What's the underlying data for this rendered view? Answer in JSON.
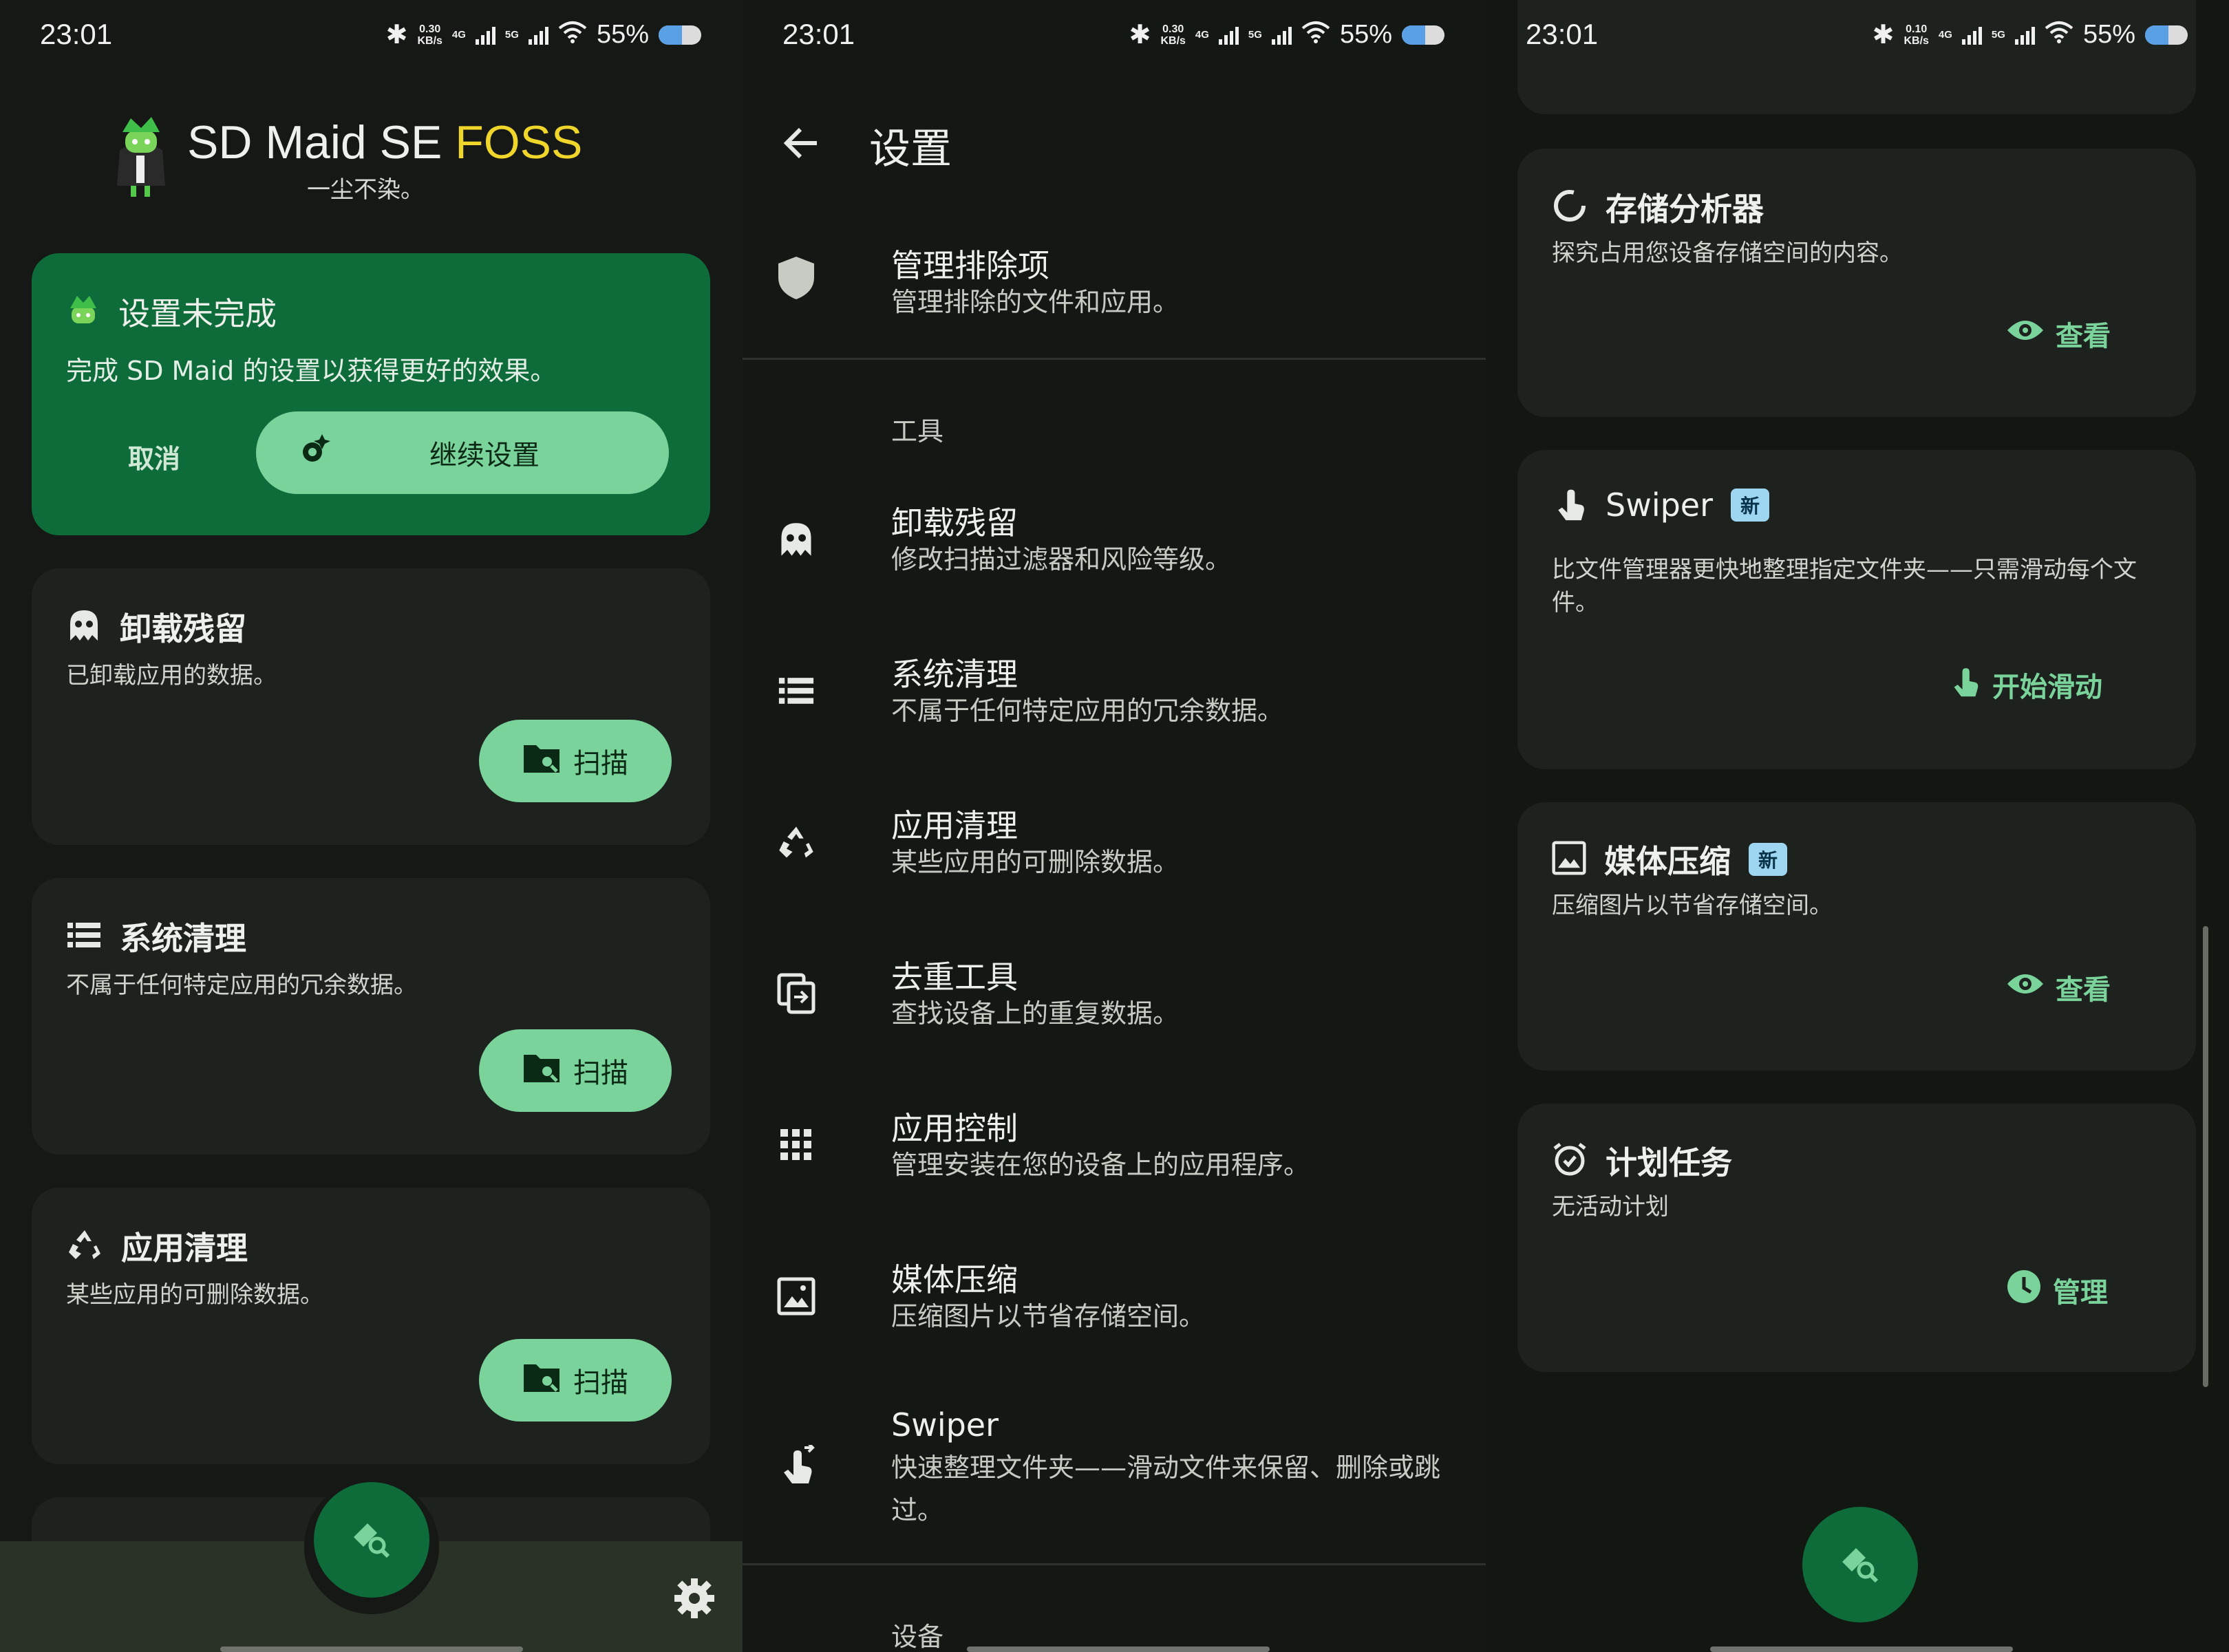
{
  "status_bar": [
    {
      "time": "23:01",
      "speed": "0.30",
      "speed_unit": "KB/s",
      "net1": "4G",
      "net2": "5G",
      "battery": "55%",
      "battery_level": 0.55
    },
    {
      "time": "23:01",
      "speed": "0.30",
      "speed_unit": "KB/s",
      "net1": "4G",
      "net2": "5G",
      "battery": "55%",
      "battery_level": 0.55
    },
    {
      "time": "23:01",
      "speed": "0.10",
      "speed_unit": "KB/s",
      "net1": "4G",
      "net2": "5G",
      "battery": "55%",
      "battery_level": 0.55
    }
  ],
  "dashboard": {
    "app_name_main": "SD Maid SE ",
    "app_name_accent": "FOSS",
    "tagline": "一尘不染。",
    "setup_card": {
      "title": "设置未完成",
      "description": "完成 SD Maid 的设置以获得更好的效果。",
      "cancel_label": "取消",
      "continue_label": "继续设置"
    },
    "tool_cards": [
      {
        "title": "卸载残留",
        "description": "已卸载应用的数据。",
        "action": "扫描",
        "icon": "ghost-icon"
      },
      {
        "title": "系统清理",
        "description": "不属于任何特定应用的冗余数据。",
        "action": "扫描",
        "icon": "list-icon"
      },
      {
        "title": "应用清理",
        "description": "某些应用的可删除数据。",
        "action": "扫描",
        "icon": "recycle-icon"
      }
    ]
  },
  "settings": {
    "title": "设置",
    "exclusions": {
      "title": "管理排除项",
      "subtitle": "管理排除的文件和应用。"
    },
    "section_tools": "工具",
    "items": [
      {
        "title": "卸载残留",
        "subtitle": "修改扫描过滤器和风险等级。",
        "icon": "ghost-icon"
      },
      {
        "title": "系统清理",
        "subtitle": "不属于任何特定应用的冗余数据。",
        "icon": "list-icon"
      },
      {
        "title": "应用清理",
        "subtitle": "某些应用的可删除数据。",
        "icon": "recycle-icon"
      },
      {
        "title": "去重工具",
        "subtitle": "查找设备上的重复数据。",
        "icon": "duplicate-icon"
      },
      {
        "title": "应用控制",
        "subtitle": "管理安装在您的设备上的应用程序。",
        "icon": "apps-grid-icon"
      },
      {
        "title": "媒体压缩",
        "subtitle": "压缩图片以节省存储空间。",
        "icon": "image-icon"
      },
      {
        "title": "Swiper",
        "subtitle": "快速整理文件夹——滑动文件来保留、删除或跳过。",
        "icon": "swipe-icon"
      }
    ],
    "section_device": "设备"
  },
  "dashboard_more": {
    "cards": [
      {
        "title": "存储分析器",
        "badge": "",
        "description": "探究占用您设备存储空间的内容。",
        "action": "查看",
        "icon": "analyzer-icon",
        "action_icon": "eye-icon"
      },
      {
        "title": "Swiper",
        "badge": "新",
        "description": "比文件管理器更快地整理指定文件夹——只需滑动每个文件。",
        "action": "开始滑动",
        "icon": "swipe-icon",
        "action_icon": "swipe-icon"
      },
      {
        "title": "媒体压缩",
        "badge": "新",
        "description": "压缩图片以节省存储空间。",
        "action": "查看",
        "icon": "image-icon",
        "action_icon": "eye-icon"
      },
      {
        "title": "计划任务",
        "badge": "",
        "description": "无活动计划",
        "action": "管理",
        "icon": "alarm-icon",
        "action_icon": "clock-icon"
      }
    ]
  },
  "colors": {
    "accent": "#7ad39a",
    "primary": "#0e6c3b",
    "foss": "#f0d62a",
    "badge": "#9ed5f0"
  }
}
